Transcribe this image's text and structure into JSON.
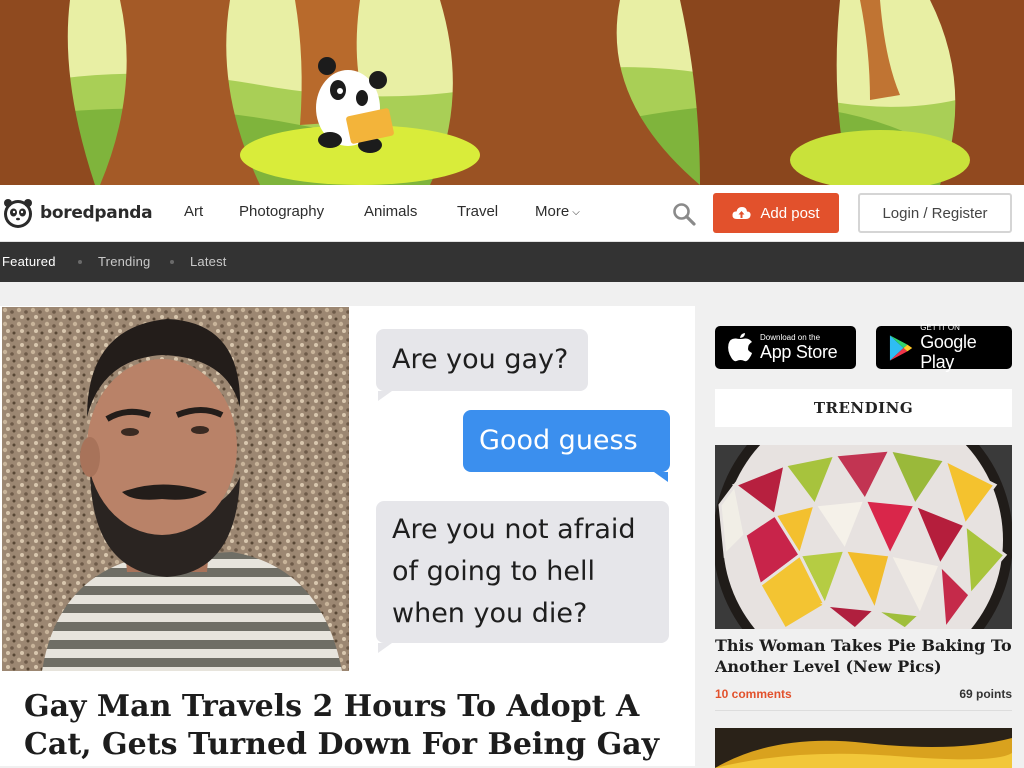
{
  "brand": {
    "name": "boredpanda"
  },
  "nav": {
    "items": [
      "Art",
      "Photography",
      "Animals",
      "Travel",
      "More"
    ],
    "add_post": "Add post",
    "login": "Login / Register"
  },
  "subnav": {
    "items": [
      "Featured",
      "Trending",
      "Latest"
    ],
    "active": "Featured"
  },
  "article": {
    "title": "Gay Man Travels 2 Hours To Adopt A Cat, Gets Turned Down For Being Gay",
    "chat": {
      "msg1": "Are you gay?",
      "msg2": "Good guess",
      "msg3_line1": "Are you not afraid",
      "msg3_line2": "of going to hell",
      "msg3_line3": "when you die?"
    }
  },
  "sidebar": {
    "app_store": {
      "small": "Download on the",
      "big": "App Store"
    },
    "google_play": {
      "small": "GET IT ON",
      "big": "Google Play"
    },
    "trending_label": "TRENDING",
    "post": {
      "title": "This Woman Takes Pie Baking To Another Level (New Pics)",
      "comments": "10 comments",
      "points": "69 points"
    }
  },
  "colors": {
    "accent": "#e2512c",
    "chat_blue": "#3b8fee",
    "subnav_bg": "#333333"
  }
}
